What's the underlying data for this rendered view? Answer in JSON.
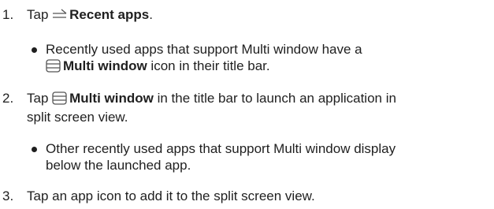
{
  "steps": [
    {
      "number": "1.",
      "prefix": "Tap ",
      "icon": "recent-apps-icon",
      "bold": "Recent apps",
      "suffix": "."
    },
    {
      "number": "2.",
      "prefix": "Tap ",
      "icon": "multi-window-icon",
      "bold": "Multi window",
      "suffix_line1": " in the title bar to launch an application in",
      "suffix_line2": "split screen view."
    },
    {
      "number": "3.",
      "text": "Tap an app icon to add it to the split screen view."
    }
  ],
  "bullets": [
    {
      "line1": "Recently used apps that support Multi window have a",
      "icon": "multi-window-icon",
      "bold": "Multi window",
      "suffix": " icon in their title bar."
    },
    {
      "line1": "Other recently used apps that support Multi window display",
      "line2": "below the launched app."
    }
  ],
  "colors": {
    "text": "#1f1f1f",
    "icon_stroke": "#555555"
  }
}
